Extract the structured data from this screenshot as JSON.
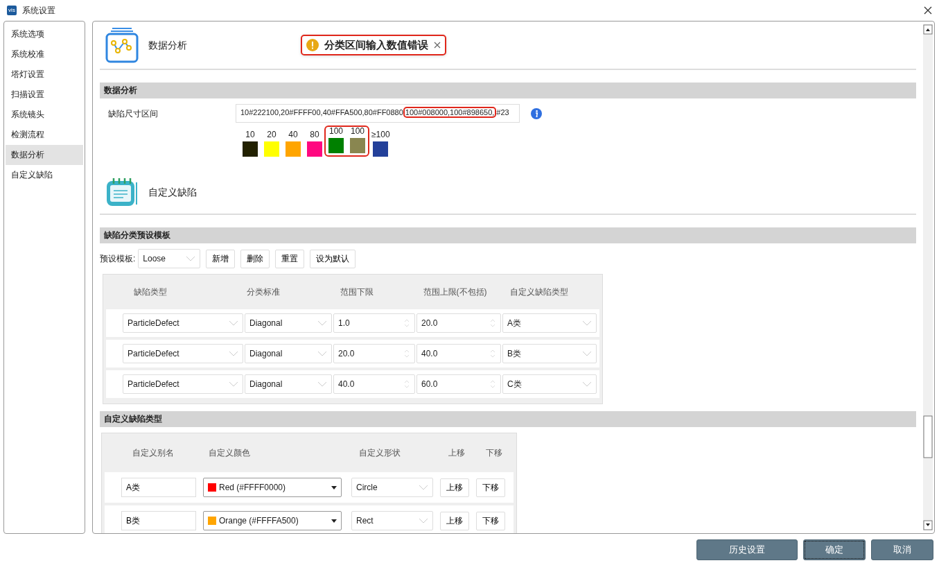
{
  "window": {
    "title": "系统设置",
    "app_icon_text": "vis"
  },
  "sidebar": {
    "items": [
      {
        "label": "系统选项",
        "selected": false
      },
      {
        "label": "系统校准",
        "selected": false
      },
      {
        "label": "塔灯设置",
        "selected": false
      },
      {
        "label": "扫描设置",
        "selected": false
      },
      {
        "label": "系统镜头",
        "selected": false
      },
      {
        "label": "检测流程",
        "selected": false
      },
      {
        "label": "数据分析",
        "selected": true
      },
      {
        "label": "自定义缺陷",
        "selected": false
      }
    ]
  },
  "header_analysis": {
    "title": "数据分析"
  },
  "toast": {
    "message": "分类区间输入数值错误",
    "highlighted": true
  },
  "section_analysis": {
    "title": "数据分析",
    "field_label": "缺陷尺寸区间",
    "value_segments": [
      {
        "text": "10#222100,20#FFFF00,40#FFA500,80#FF0880",
        "highlighted": false
      },
      {
        "text": "100#008000,100#898650,",
        "highlighted": true
      },
      {
        "text": "#23",
        "highlighted": false
      }
    ],
    "swatch_groups": [
      {
        "highlighted": false,
        "swatches": [
          {
            "label": "10",
            "color": "#222100"
          },
          {
            "label": "20",
            "color": "#ffff00"
          },
          {
            "label": "40",
            "color": "#ffa500"
          },
          {
            "label": "80",
            "color": "#ff0880"
          }
        ]
      },
      {
        "highlighted": true,
        "swatches": [
          {
            "label": "100",
            "color": "#008000"
          },
          {
            "label": "100",
            "color": "#898650"
          }
        ]
      },
      {
        "highlighted": false,
        "swatches": [
          {
            "label": "≥100",
            "color": "#23409a"
          }
        ]
      }
    ]
  },
  "header_custom": {
    "title": "自定义缺陷"
  },
  "section_templates": {
    "title": "缺陷分类预设模板",
    "template_label": "预设模板:",
    "template_value": "Loose",
    "buttons": [
      "新增",
      "删除",
      "重置",
      "设为默认"
    ],
    "columns": [
      "缺陷类型",
      "分类标准",
      "范围下限",
      "范围上限(不包括)",
      "自定义缺陷类型"
    ],
    "rows": [
      {
        "defect_type": "ParticleDefect",
        "criterion": "Diagonal",
        "lower": "1.0",
        "upper": "20.0",
        "custom_type": "A类"
      },
      {
        "defect_type": "ParticleDefect",
        "criterion": "Diagonal",
        "lower": "20.0",
        "upper": "40.0",
        "custom_type": "B类"
      },
      {
        "defect_type": "ParticleDefect",
        "criterion": "Diagonal",
        "lower": "40.0",
        "upper": "60.0",
        "custom_type": "C类"
      }
    ]
  },
  "section_custom_types": {
    "title": "自定义缺陷类型",
    "columns": [
      "自定义别名",
      "自定义颜色",
      "自定义形状",
      "上移",
      "下移"
    ],
    "rows": [
      {
        "alias": "A类",
        "color_name": "Red (#FFFF0000)",
        "color": "#ff0000",
        "shape": "Circle",
        "up": "上移",
        "down": "下移"
      },
      {
        "alias": "B类",
        "color_name": "Orange (#FFFFA500)",
        "color": "#ffa500",
        "shape": "Rect",
        "up": "上移",
        "down": "下移"
      }
    ]
  },
  "footer": {
    "buttons": [
      {
        "label": "历史设置",
        "focused": false
      },
      {
        "label": "确定",
        "focused": true
      },
      {
        "label": "取消",
        "focused": false
      }
    ]
  }
}
